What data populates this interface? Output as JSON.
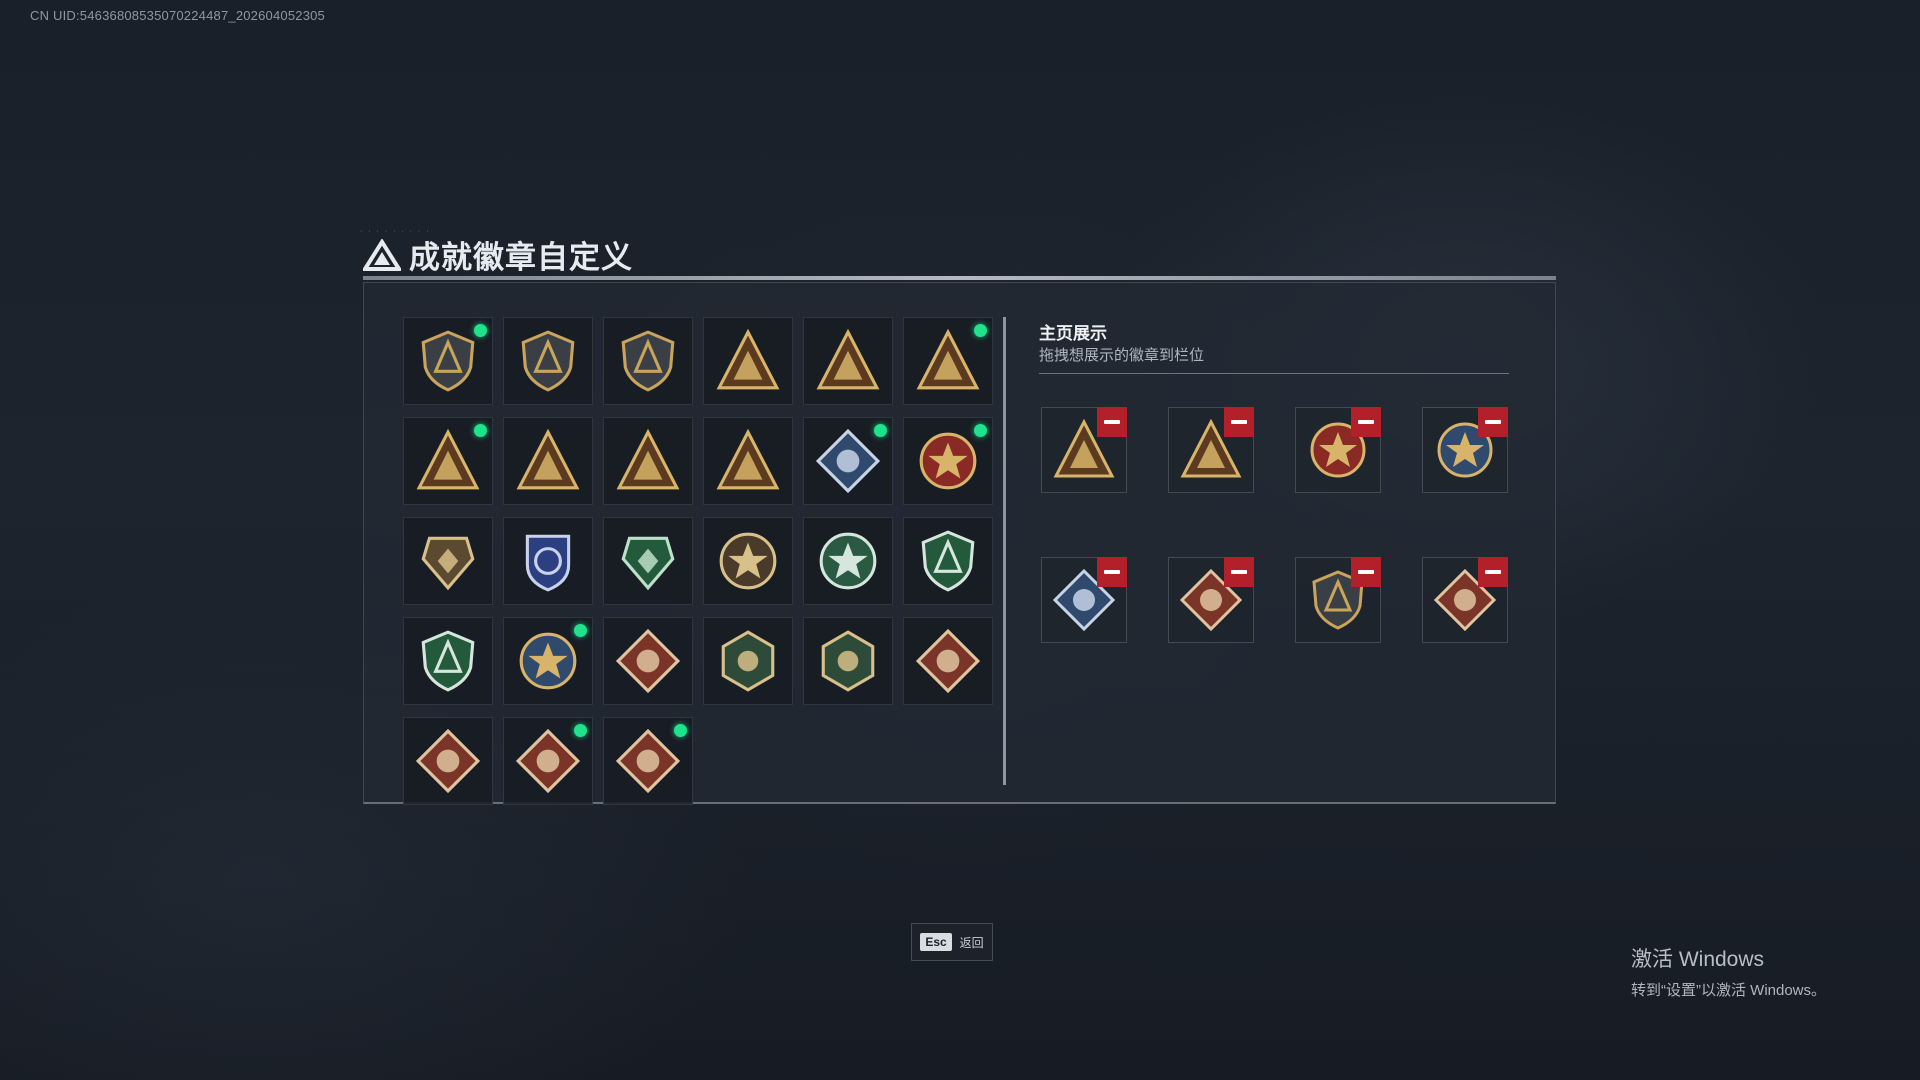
{
  "uid_text": "CN UID:5463680853507022448​7_202604052305",
  "title": "成就徽章自定义",
  "showcase": {
    "title": "主页展示",
    "subtitle": "拖拽想展示的徽章到栏位"
  },
  "badges": [
    {
      "icon": "gold-shield-triangle-icon",
      "type": "shield",
      "fill": "#3a3f45",
      "fg": "#c9a45c",
      "new": true
    },
    {
      "icon": "gold-shield-helicopter-icon",
      "type": "shield",
      "fill": "#3a3f45",
      "fg": "#c9a45c",
      "new": false
    },
    {
      "icon": "gold-shield-sword-icon",
      "type": "shield",
      "fill": "#3a3f45",
      "fg": "#c9a45c",
      "new": false
    },
    {
      "icon": "triangle-5r-icon",
      "type": "triangle",
      "fill": "#5b3a1f",
      "fg": "#d8b46a",
      "new": false
    },
    {
      "icon": "triangle-5b-icon",
      "type": "triangle",
      "fill": "#5b3a1f",
      "fg": "#d8b46a",
      "new": false
    },
    {
      "icon": "triangle-helmet-icon",
      "type": "triangle",
      "fill": "#5b3a1f",
      "fg": "#d8b46a",
      "new": true
    },
    {
      "icon": "triangle-tank-icon",
      "type": "triangle",
      "fill": "#5b3a1f",
      "fg": "#d8b46a",
      "new": true
    },
    {
      "icon": "triangle-number-one-icon",
      "type": "triangle",
      "fill": "#5b3a1f",
      "fg": "#d8b46a",
      "new": false
    },
    {
      "icon": "triangle-soldier-icon",
      "type": "triangle",
      "fill": "#5b3a1f",
      "fg": "#d8b46a",
      "new": false
    },
    {
      "icon": "triangle-warrior-icon",
      "type": "triangle",
      "fill": "#5b3a1f",
      "fg": "#d8b46a",
      "new": false
    },
    {
      "icon": "diamond-blue-launcher-icon",
      "type": "diamond",
      "fill": "#2f4a6c",
      "fg": "#c7d4e6",
      "new": true
    },
    {
      "icon": "red-star-medal-icon",
      "type": "round",
      "fill": "#8a2a24",
      "fg": "#d8b46a",
      "new": true
    },
    {
      "icon": "gold-hex-shield-icon",
      "type": "hexshield",
      "fill": "#5b4a30",
      "fg": "#d8c08a",
      "new": false
    },
    {
      "icon": "blue-police-shield-icon",
      "type": "badge",
      "fill": "#2c3f80",
      "fg": "#c8d2ea",
      "new": false
    },
    {
      "icon": "green-hex-shield-icon",
      "type": "hexshield",
      "fill": "#245a3c",
      "fg": "#bde0c8",
      "new": false
    },
    {
      "icon": "crosshair-skull-icon",
      "type": "round",
      "fill": "#4a3a2a",
      "fg": "#d8c08a",
      "new": false
    },
    {
      "icon": "green-gear-skull-icon",
      "type": "round",
      "fill": "#2a5a42",
      "fg": "#d6e6dc",
      "new": false
    },
    {
      "icon": "green-wreath-rifle-icon",
      "type": "shield",
      "fill": "#245a3c",
      "fg": "#d6e6dc",
      "new": false
    },
    {
      "icon": "green-wreath-gun-icon",
      "type": "shield",
      "fill": "#245a3c",
      "fg": "#d6e6dc",
      "new": false
    },
    {
      "icon": "gold-eagle-crest-icon",
      "type": "round",
      "fill": "#2f4a6c",
      "fg": "#d8b46a",
      "new": true
    },
    {
      "icon": "red-diamond-wolf-icon",
      "type": "diamond",
      "fill": "#7a3528",
      "fg": "#e0c4a0",
      "new": false
    },
    {
      "icon": "green-hex-wasp-icon",
      "type": "hex",
      "fill": "#2e4a38",
      "fg": "#d8c08a",
      "new": false
    },
    {
      "icon": "green-hex-figure-icon",
      "type": "hex",
      "fill": "#2e4a38",
      "fg": "#d8c08a",
      "new": false
    },
    {
      "icon": "red-diamond-dragon-icon",
      "type": "diamond",
      "fill": "#7a3528",
      "fg": "#e0c4a0",
      "new": false
    },
    {
      "icon": "red-diamond-dragon-head-icon",
      "type": "diamond",
      "fill": "#7a3528",
      "fg": "#e0c4a0",
      "new": false
    },
    {
      "icon": "red-diamond-runner-icon",
      "type": "diamond",
      "fill": "#7a3528",
      "fg": "#e0c4a0",
      "new": true
    },
    {
      "icon": "red-diamond-vest-icon",
      "type": "diamond",
      "fill": "#7a3528",
      "fg": "#e0c4a0",
      "new": true
    }
  ],
  "showcase_slots": [
    {
      "icon": "triangle-tank-icon",
      "type": "triangle",
      "fill": "#5b3a1f",
      "fg": "#d8b46a"
    },
    {
      "icon": "triangle-helmet-icon",
      "type": "triangle",
      "fill": "#5b3a1f",
      "fg": "#d8b46a"
    },
    {
      "icon": "red-star-medal-icon",
      "type": "round",
      "fill": "#8a2a24",
      "fg": "#d8b46a"
    },
    {
      "icon": "gold-eagle-crest-icon",
      "type": "round",
      "fill": "#2f4a6c",
      "fg": "#d8b46a"
    },
    {
      "icon": "diamond-blue-launcher-icon",
      "type": "diamond",
      "fill": "#2f4a6c",
      "fg": "#c7d4e6"
    },
    {
      "icon": "red-diamond-vest-icon",
      "type": "diamond",
      "fill": "#7a3528",
      "fg": "#e0c4a0"
    },
    {
      "icon": "gold-shield-triangle-icon",
      "type": "shield",
      "fill": "#3a3f45",
      "fg": "#c9a45c"
    },
    {
      "icon": "red-diamond-runner-icon",
      "type": "diamond",
      "fill": "#7a3528",
      "fg": "#e0c4a0"
    }
  ],
  "footer": {
    "esc_key": "Esc",
    "esc_label": "返回"
  },
  "windows_activation": {
    "title": "激活 Windows",
    "subtitle": "转到“设置”以激活 Windows。"
  },
  "colors": {
    "accent_new": "#1ee38c",
    "remove": "#b3202a"
  }
}
